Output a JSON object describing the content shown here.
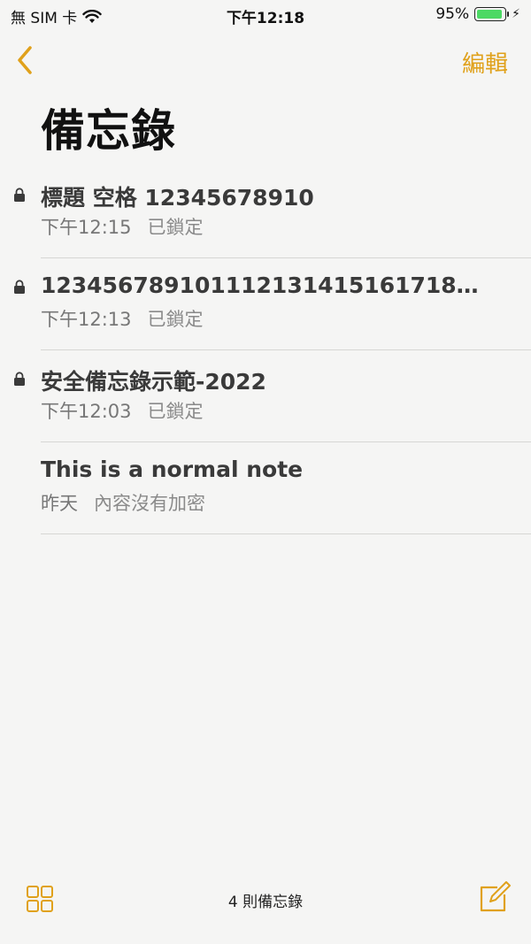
{
  "status": {
    "carrier": "無 SIM 卡",
    "time": "下午12:18",
    "battery": "95%",
    "battery_level": 0.95,
    "wifi_icon": "wifi-icon",
    "charging_icon": "charging-bolt-icon"
  },
  "nav": {
    "back_icon": "chevron-left-icon",
    "edit_label": "編輯",
    "title": "備忘錄"
  },
  "notes": [
    {
      "title": "標題 空格 12345678910",
      "date": "下午12:15",
      "preview": "已鎖定",
      "locked": true
    },
    {
      "title": "1234567891011121314151617181920...",
      "date": "下午12:13",
      "preview": "已鎖定",
      "locked": true
    },
    {
      "title": "安全備忘錄示範-2022",
      "date": "下午12:03",
      "preview": "已鎖定",
      "locked": true
    },
    {
      "title": "This is a normal note",
      "date": "昨天",
      "preview": "內容沒有加密",
      "locked": false
    }
  ],
  "toolbar": {
    "count_label": "4 則備忘錄",
    "grid_icon": "gallery-grid-icon",
    "compose_icon": "compose-icon"
  },
  "colors": {
    "accent": "#e0a11b",
    "background": "#f5f5f4",
    "battery_green": "#4cd964"
  }
}
